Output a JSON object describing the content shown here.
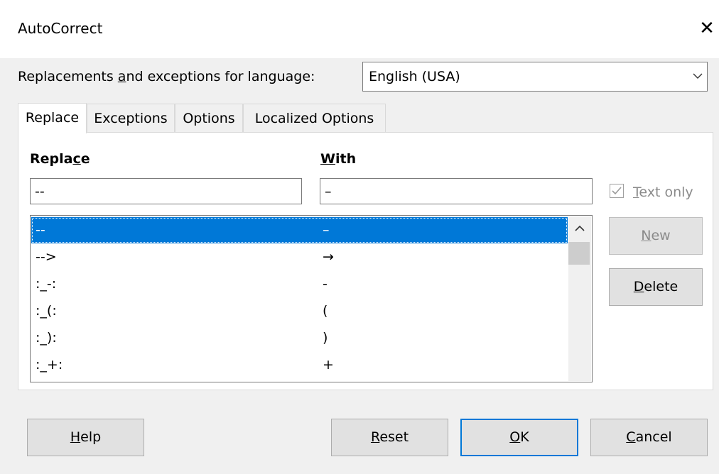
{
  "window": {
    "title": "AutoCorrect",
    "close_glyph": "✕"
  },
  "language": {
    "label_pre": "Replacements ",
    "label_u": "a",
    "label_post": "nd exceptions for language:",
    "value": "English (USA)"
  },
  "tabs": [
    {
      "label": "Replace"
    },
    {
      "label": "Exceptions"
    },
    {
      "label": "Options"
    },
    {
      "label": "Localized Options"
    }
  ],
  "replace": {
    "replace_header_pre": "Repla",
    "replace_header_u": "c",
    "replace_header_post": "e",
    "with_header_u": "W",
    "with_header_post": "ith",
    "replace_value": "--",
    "with_value": "–",
    "text_only_u": "T",
    "text_only_post": "ext only",
    "text_only_checked": true,
    "rows": [
      {
        "replace": "--",
        "with": "–"
      },
      {
        "replace": "-->",
        "with": "→"
      },
      {
        "replace": ":_-:",
        "with": "-"
      },
      {
        "replace": ":_(:",
        "with": "("
      },
      {
        "replace": ":_):",
        "with": ")"
      },
      {
        "replace": ":_+:",
        "with": "+"
      }
    ],
    "new_u": "N",
    "new_post": "ew",
    "delete_u": "D",
    "delete_post": "elete"
  },
  "footer": {
    "help_u": "H",
    "help_post": "elp",
    "reset_u": "R",
    "reset_post": "eset",
    "ok_u": "O",
    "ok_post": "K",
    "cancel_u": "C",
    "cancel_post": "ancel"
  }
}
